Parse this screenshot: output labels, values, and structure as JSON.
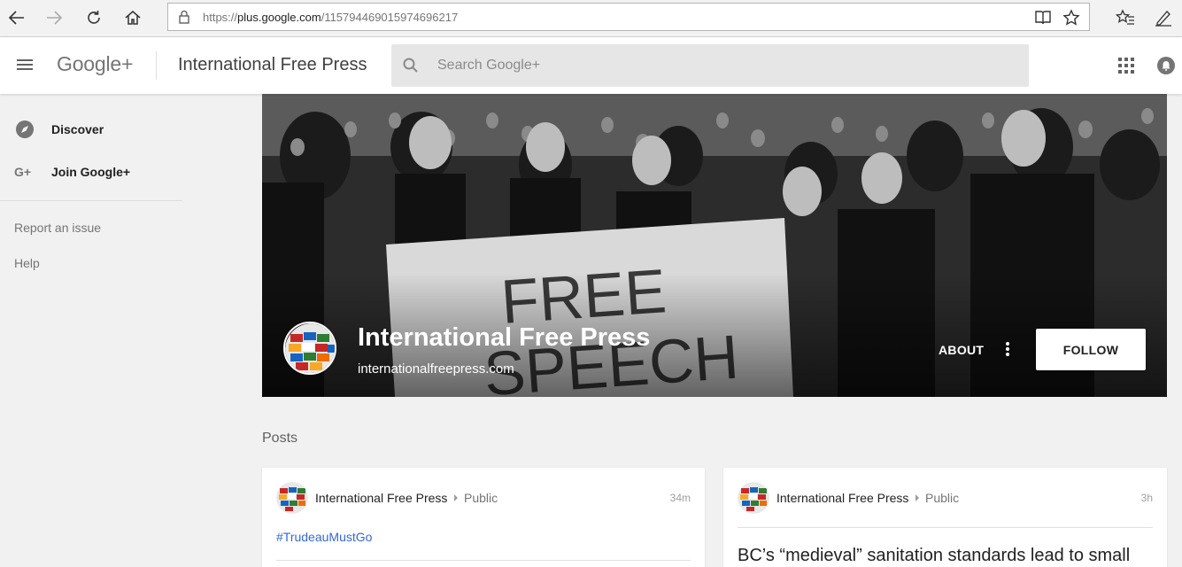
{
  "browser": {
    "url_prefix": "https://",
    "url_host": "plus.google.com",
    "url_path": "/115794469015974696217",
    "icons": [
      "back-arrow-icon",
      "forward-arrow-icon",
      "refresh-icon",
      "home-icon",
      "lock-icon",
      "reading-view-icon",
      "favorite-star-icon",
      "favorites-list-icon",
      "pen-icon"
    ]
  },
  "header": {
    "logo": "Google+",
    "title": "International Free Press",
    "search_placeholder": "Search Google+",
    "icons": [
      "menu-icon",
      "search-icon",
      "apps-grid-icon",
      "notifications-icon"
    ]
  },
  "sidebar": {
    "items": [
      {
        "label": "Discover",
        "icon": "compass-icon"
      },
      {
        "label": "Join Google+",
        "icon": "google-plus-icon"
      }
    ],
    "links": [
      "Report an issue",
      "Help"
    ]
  },
  "profile": {
    "name": "International Free Press",
    "website": "internationalfreepress.com",
    "about_label": "ABOUT",
    "follow_label": "FOLLOW",
    "cover_banner_text": "FREE SPEECH"
  },
  "posts": {
    "heading": "Posts",
    "items": [
      {
        "author": "International Free Press",
        "visibility": "Public",
        "time": "34m",
        "hashtag": "#TrudeauMustGo"
      },
      {
        "author": "International Free Press",
        "visibility": "Public",
        "time": "3h",
        "headline": "BC’s “medieval” sanitation standards lead to small"
      }
    ]
  },
  "colors": {
    "link_blue": "#3367d6",
    "page_bg": "#f1f1f1",
    "search_bg": "#e6e6e6"
  }
}
